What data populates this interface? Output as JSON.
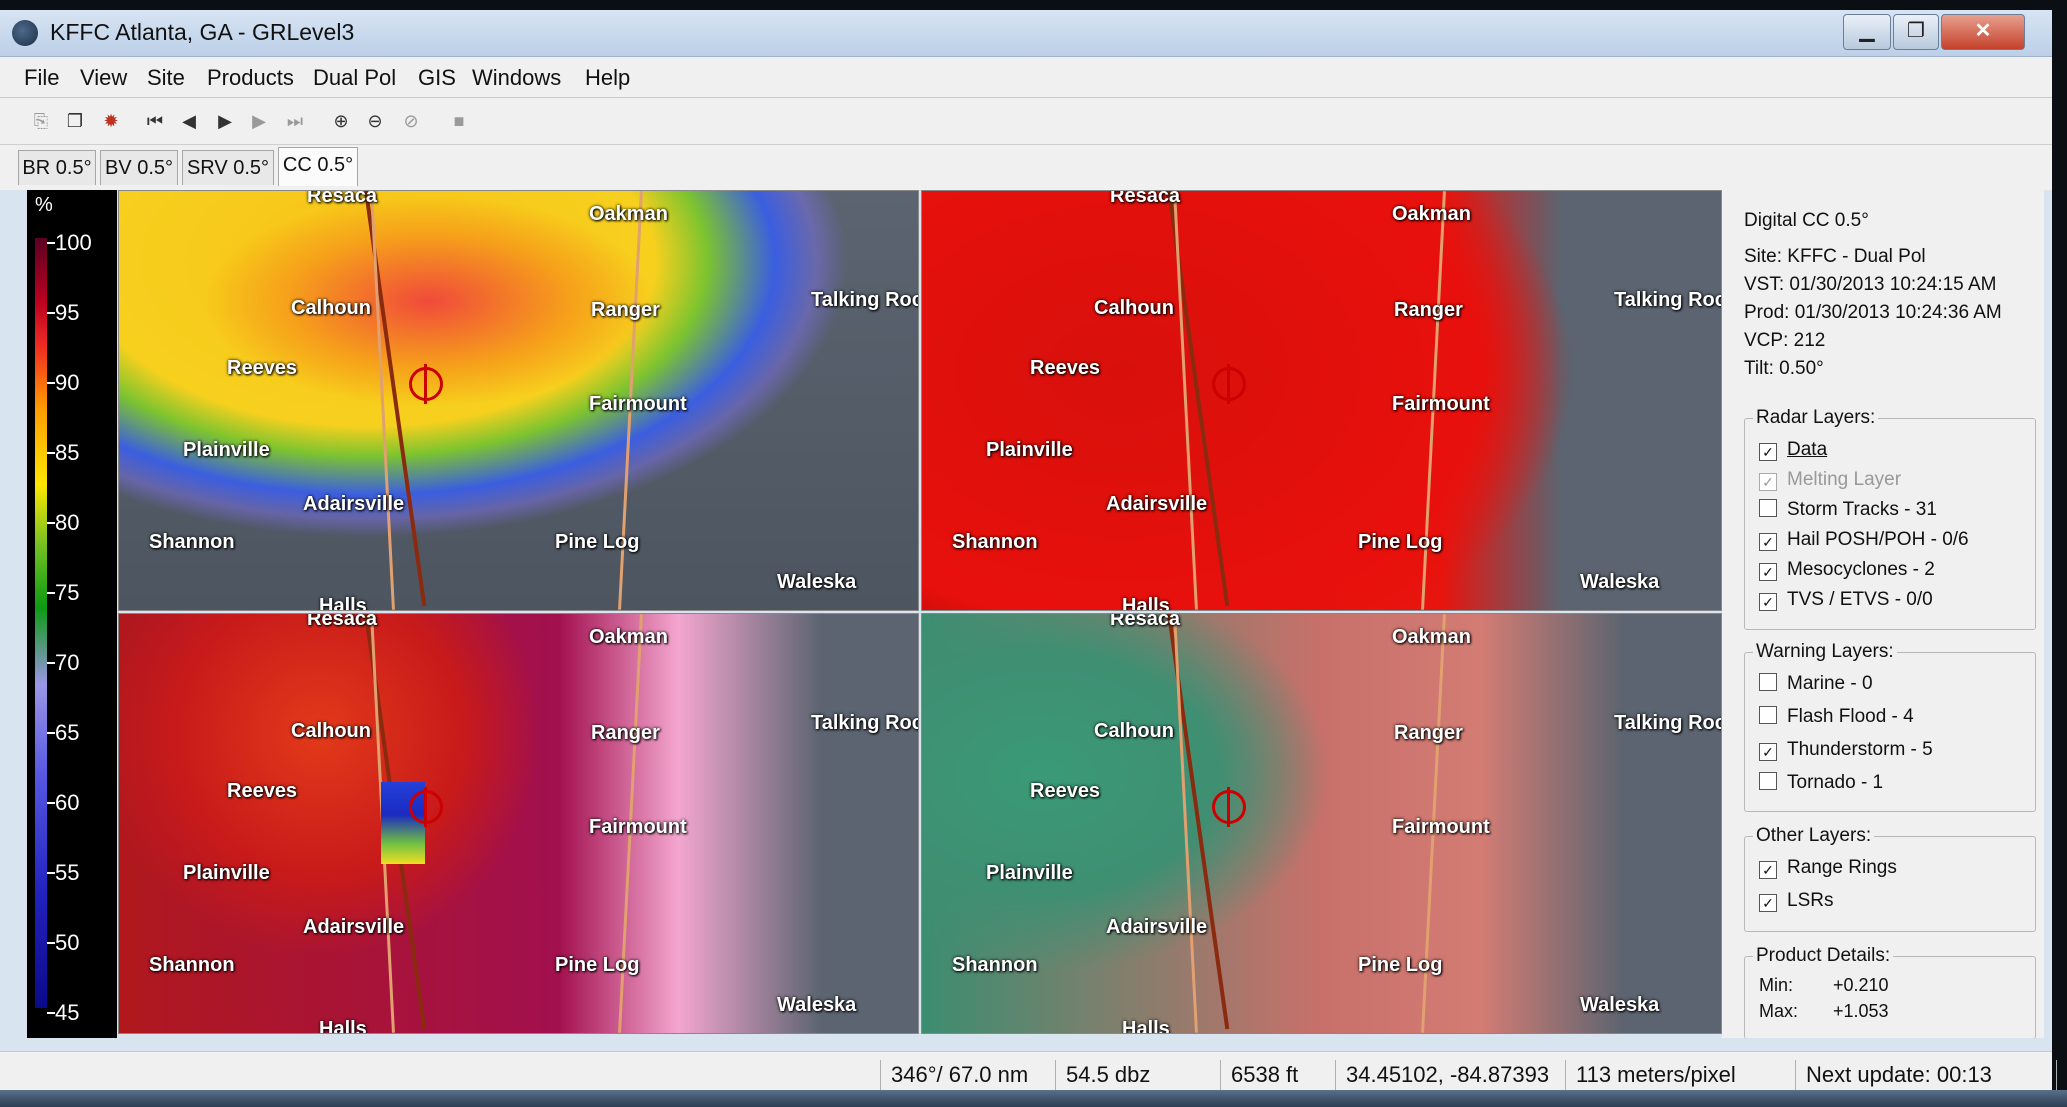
{
  "window": {
    "title": "KFFC Atlanta, GA - GRLevel3",
    "min_label": "▁",
    "max_label": "❐",
    "close_label": "✕"
  },
  "menu": [
    "File",
    "View",
    "Site",
    "Products",
    "Dual Pol",
    "GIS",
    "Windows",
    "Help"
  ],
  "toolbar_icons": [
    "copy-icon",
    "paste-icon",
    "settings-icon",
    "first-frame-icon",
    "prev-frame-icon",
    "play-icon",
    "next-frame-icon",
    "last-frame-icon",
    "zoom-in-icon",
    "zoom-out-icon",
    "zoom-reset-icon",
    "stop-icon"
  ],
  "tabs": [
    "BR 0.5°",
    "BV 0.5°",
    "SRV 0.5°",
    "CC 0.5°"
  ],
  "active_tab": "CC 0.5°",
  "colorbar": {
    "unit": "%",
    "labels": [
      "100",
      "95",
      "90",
      "85",
      "80",
      "75",
      "70",
      "65",
      "60",
      "55",
      "50",
      "45"
    ]
  },
  "places": {
    "resaca": "Resaca",
    "oakman": "Oakman",
    "calhoun": "Calhoun",
    "ranger": "Ranger",
    "talking_rock": "Talking Roc",
    "reeves": "Reeves",
    "fairmount": "Fairmount",
    "plainville": "Plainville",
    "adairsville": "Adairsville",
    "shannon": "Shannon",
    "pine_log": "Pine Log",
    "waleska": "Waleska",
    "halls": "Halls"
  },
  "info": {
    "product": "Digital CC 0.5°",
    "site": "Site:  KFFC - Dual Pol",
    "vst": "VST:  01/30/2013  10:24:15 AM",
    "prod": "Prod: 01/30/2013  10:24:36 AM",
    "vcp": "VCP:  212",
    "tilt": "Tilt:   0.50°"
  },
  "radar_layers": {
    "title": "Radar Layers:",
    "items": [
      {
        "label": "Data",
        "checked": "✓"
      },
      {
        "label": "Melting Layer",
        "checked": "✓"
      },
      {
        "label": "Storm Tracks - 31",
        "checked": ""
      },
      {
        "label": "Hail POSH/POH - 0/6",
        "checked": "✓"
      },
      {
        "label": "Mesocyclones - 2",
        "checked": "✓"
      },
      {
        "label": "TVS / ETVS - 0/0",
        "checked": "✓"
      }
    ]
  },
  "warning_layers": {
    "title": "Warning Layers:",
    "items": [
      {
        "label": "Marine - 0",
        "checked": ""
      },
      {
        "label": "Flash Flood - 4",
        "checked": ""
      },
      {
        "label": "Thunderstorm - 5",
        "checked": "✓"
      },
      {
        "label": "Tornado - 1",
        "checked": ""
      }
    ]
  },
  "other_layers": {
    "title": "Other Layers:",
    "items": [
      {
        "label": "Range Rings",
        "checked": "✓"
      },
      {
        "label": "LSRs",
        "checked": "✓"
      }
    ]
  },
  "product_details": {
    "title": "Product Details:",
    "min_label": "Min:",
    "min_value": "+0.210",
    "max_label": "Max:",
    "max_value": "+1.053"
  },
  "status": {
    "azimuth": "346°/ 67.0 nm",
    "value": "54.5 dbz",
    "height": "6538 ft",
    "latlon": "34.45102, -84.87393",
    "resolution": "113 meters/pixel",
    "next_update": "Next update: 00:13"
  }
}
